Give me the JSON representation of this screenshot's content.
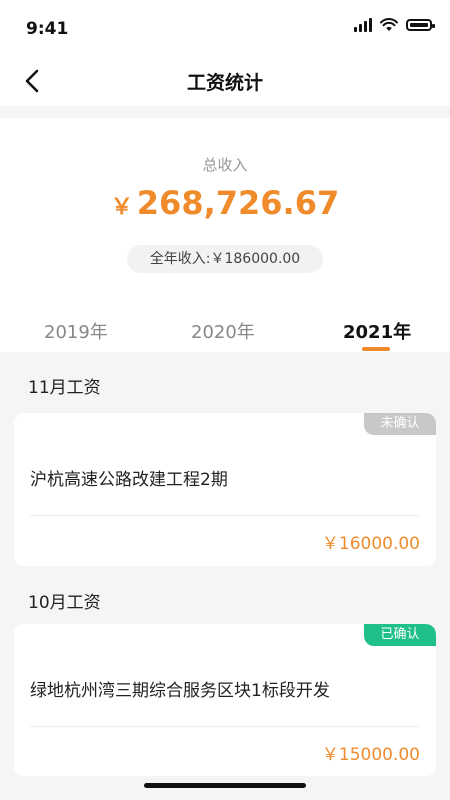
{
  "status": {
    "time": "9:41"
  },
  "nav": {
    "title": "工资统计"
  },
  "summary": {
    "label": "总收入",
    "currency": "￥",
    "amount": "268,726.67",
    "annual": "全年收入:￥186000.00"
  },
  "tabs": [
    {
      "label": "2019年",
      "active": false
    },
    {
      "label": "2020年",
      "active": false
    },
    {
      "label": "2021年",
      "active": true
    }
  ],
  "months": [
    {
      "title": "11月工资",
      "project": "沪杭高速公路改建工程2期",
      "status": "未确认",
      "status_color": "#c8c8c8",
      "amount": "￥16000.00"
    },
    {
      "title": "10月工资",
      "project": "绿地杭州湾三期综合服务区块1标段开发",
      "status": "已确认",
      "status_color": "#1fc08a",
      "amount": "￥15000.00"
    }
  ],
  "colors": {
    "accent": "#f08b2c"
  }
}
